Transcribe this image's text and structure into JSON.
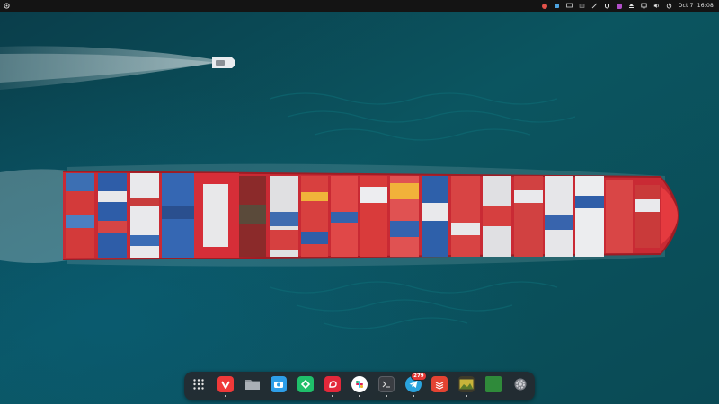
{
  "topbar": {
    "activities_icon": "activities-icon",
    "tray_icons": [
      "color-picker-icon",
      "stacked-app-icon",
      "screen-icon",
      "window-icon",
      "clipboard-icon",
      "magnet-icon",
      "app-indicator-icon",
      "eject-icon",
      "display-icon",
      "volume-icon",
      "power-icon"
    ],
    "date": "Oct 7",
    "time": "16:08"
  },
  "desktop": {
    "wallpaper": "aerial-container-ship-wallpaper",
    "sea_color": "#0b5560"
  },
  "dock": {
    "items": [
      {
        "name": "show-apps",
        "icon": "grid-icon",
        "color": "#00000000",
        "running": false
      },
      {
        "name": "vivaldi",
        "icon": "vivaldi-icon",
        "color": "#ef3939",
        "running": true
      },
      {
        "name": "files",
        "icon": "folder-icon",
        "color": "#8f969c",
        "running": false
      },
      {
        "name": "camera",
        "icon": "camera-icon",
        "color": "#2e9ee8",
        "running": false
      },
      {
        "name": "sync",
        "icon": "sync-icon",
        "color": "#1fbf6a",
        "running": false
      },
      {
        "name": "app-red",
        "icon": "red-app-icon",
        "color": "#e3283a",
        "running": true
      },
      {
        "name": "slack",
        "icon": "slack-icon",
        "color": "#ffffff",
        "running": true
      },
      {
        "name": "terminal",
        "icon": "terminal-icon",
        "color": "#3a3d42",
        "running": true
      },
      {
        "name": "telegram",
        "icon": "telegram-icon",
        "color": "#2aa3dd",
        "running": true,
        "badge": "279"
      },
      {
        "name": "todoist",
        "icon": "todoist-icon",
        "color": "#e44332",
        "running": false
      },
      {
        "name": "image-viewer",
        "icon": "image-viewer-icon",
        "color": "#c8b43a",
        "running": true
      },
      {
        "name": "green-app",
        "icon": "green-square-icon",
        "color": "#2f8a3a",
        "running": false
      },
      {
        "name": "settings",
        "icon": "gear-icon",
        "color": "#7b7f86",
        "running": false
      }
    ]
  }
}
